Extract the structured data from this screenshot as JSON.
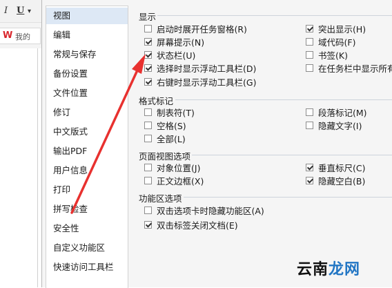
{
  "toolbar": {
    "italic_label": "I",
    "underline_label": "U",
    "dropdown_label": "▾",
    "brand_logo": "W",
    "doc_tab_label": "我的"
  },
  "nav": {
    "items": [
      {
        "label": "视图",
        "active": true
      },
      {
        "label": "编辑"
      },
      {
        "label": "常规与保存"
      },
      {
        "label": "备份设置"
      },
      {
        "label": "文件位置"
      },
      {
        "label": "修订"
      },
      {
        "label": "中文版式"
      },
      {
        "label": "输出PDF"
      },
      {
        "label": "用户信息"
      },
      {
        "label": "打印"
      },
      {
        "label": "拼写检查"
      },
      {
        "label": "安全性"
      },
      {
        "label": "自定义功能区"
      },
      {
        "label": "快速访问工具栏"
      }
    ]
  },
  "groups": {
    "display": {
      "title": "显示",
      "options": [
        {
          "label": "启动时展开任务窗格(R)",
          "checked": false
        },
        {
          "label": "屏幕提示(N)",
          "checked": true
        },
        {
          "label": "状态栏(U)",
          "checked": true
        },
        {
          "label": "选择时显示浮动工具栏(D)",
          "checked": true
        },
        {
          "label": "右键时显示浮动工具栏(G)",
          "checked": true
        },
        {
          "label": "突出显示(H)",
          "checked": true
        },
        {
          "label": "域代码(F)",
          "checked": false
        },
        {
          "label": "书签(K)",
          "checked": false
        },
        {
          "label": "在任务栏中显示所有窗口",
          "checked": false
        }
      ]
    },
    "format_marks": {
      "title": "格式标记",
      "options": [
        {
          "label": "制表符(T)",
          "checked": false
        },
        {
          "label": "空格(S)",
          "checked": false
        },
        {
          "label": "全部(L)",
          "checked": false
        },
        {
          "label": "段落标记(M)",
          "checked": false
        },
        {
          "label": "隐藏文字(I)",
          "checked": false
        }
      ]
    },
    "page_view": {
      "title": "页面视图选项",
      "options": [
        {
          "label": "对象位置(J)",
          "checked": false
        },
        {
          "label": "正文边框(X)",
          "checked": false
        },
        {
          "label": "垂直标尺(C)",
          "checked": true
        },
        {
          "label": "隐藏空白(B)",
          "checked": true
        }
      ]
    },
    "ribbon": {
      "title": "功能区选项",
      "options": [
        {
          "label": "双击选项卡时隐藏功能区(A)",
          "checked": false
        },
        {
          "label": "双击标签关闭文档(E)",
          "checked": true
        }
      ]
    }
  },
  "colors": {
    "arrow": "#e8312f",
    "nav_active": "#dde8f5",
    "wps_red": "#d9262c",
    "watermark_blue": "#2276c4"
  },
  "watermark": {
    "part1": "云南",
    "part2": "龙网"
  }
}
